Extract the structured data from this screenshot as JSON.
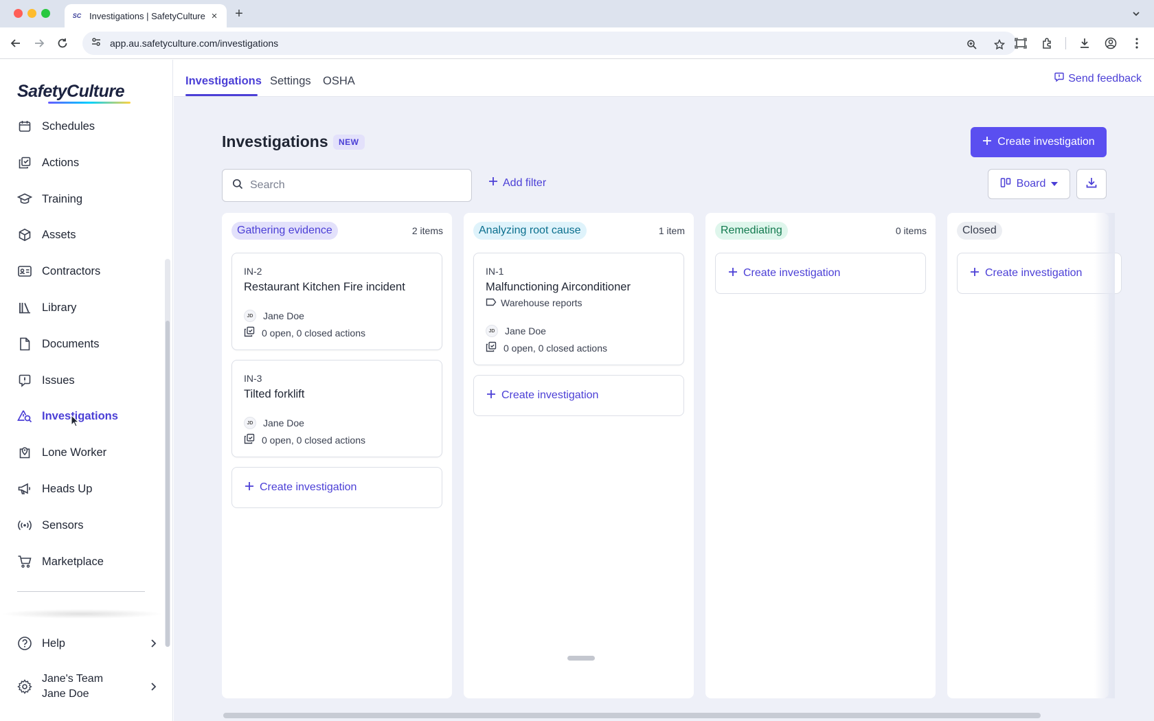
{
  "browser": {
    "tab_title": "Investigations | SafetyCulture",
    "tab_favicon": "SC",
    "url": "app.au.safetyculture.com/investigations"
  },
  "sidebar": {
    "logo": "SafetyCulture",
    "items": [
      {
        "label": "Schedules",
        "icon": "calendar-icon"
      },
      {
        "label": "Actions",
        "icon": "actions-icon"
      },
      {
        "label": "Training",
        "icon": "graduation-cap-icon"
      },
      {
        "label": "Assets",
        "icon": "cube-icon"
      },
      {
        "label": "Contractors",
        "icon": "id-card-icon"
      },
      {
        "label": "Library",
        "icon": "library-icon"
      },
      {
        "label": "Documents",
        "icon": "document-icon"
      },
      {
        "label": "Issues",
        "icon": "issue-icon"
      },
      {
        "label": "Investigations",
        "icon": "investigation-icon",
        "active": true
      },
      {
        "label": "Lone Worker",
        "icon": "map-pin-icon"
      },
      {
        "label": "Heads Up",
        "icon": "megaphone-icon"
      },
      {
        "label": "Sensors",
        "icon": "sensor-icon"
      },
      {
        "label": "Marketplace",
        "icon": "cart-icon"
      }
    ],
    "help_label": "Help",
    "team_name": "Jane's Team",
    "user_name": "Jane Doe"
  },
  "subnav": {
    "tabs": [
      "Investigations",
      "Settings",
      "OSHA"
    ],
    "active_tab": "Investigations",
    "feedback_label": "Send feedback"
  },
  "page": {
    "title": "Investigations",
    "badge": "NEW",
    "create_button": "Create investigation",
    "search_placeholder": "Search",
    "add_filter": "Add filter",
    "view_label": "Board"
  },
  "columns": [
    {
      "name": "Gathering evidence",
      "count": "2 items",
      "pill_bg": "#e3e1fb",
      "pill_fg": "#4b3fd6",
      "cards": [
        {
          "id": "IN-2",
          "title": "Restaurant Kitchen Fire incident",
          "assignee": "Jane Doe",
          "initials": "JD",
          "actions": "0 open, 0 closed actions"
        },
        {
          "id": "IN-3",
          "title": "Tilted forklift",
          "assignee": "Jane Doe",
          "initials": "JD",
          "actions": "0 open, 0 closed actions"
        }
      ],
      "create_label": "Create investigation"
    },
    {
      "name": "Analyzing root cause",
      "count": "1 item",
      "pill_bg": "#dff3fb",
      "pill_fg": "#0b6f8e",
      "cards": [
        {
          "id": "IN-1",
          "title": "Malfunctioning Airconditioner",
          "tag": "Warehouse reports",
          "assignee": "Jane Doe",
          "initials": "JD",
          "actions": "0 open, 0 closed actions"
        }
      ],
      "create_label": "Create investigation"
    },
    {
      "name": "Remediating",
      "count": "0 items",
      "pill_bg": "#dff6ec",
      "pill_fg": "#137a4f",
      "cards": [],
      "create_label": "Create investigation"
    },
    {
      "name": "Closed",
      "count": "",
      "pill_bg": "#eceef2",
      "pill_fg": "#3a4050",
      "cards": [],
      "create_label": "Create investigation"
    }
  ],
  "colors": {
    "accent": "#5a4ff0",
    "accent_text": "#4b3fd6",
    "board_bg": "#eef0f8"
  }
}
